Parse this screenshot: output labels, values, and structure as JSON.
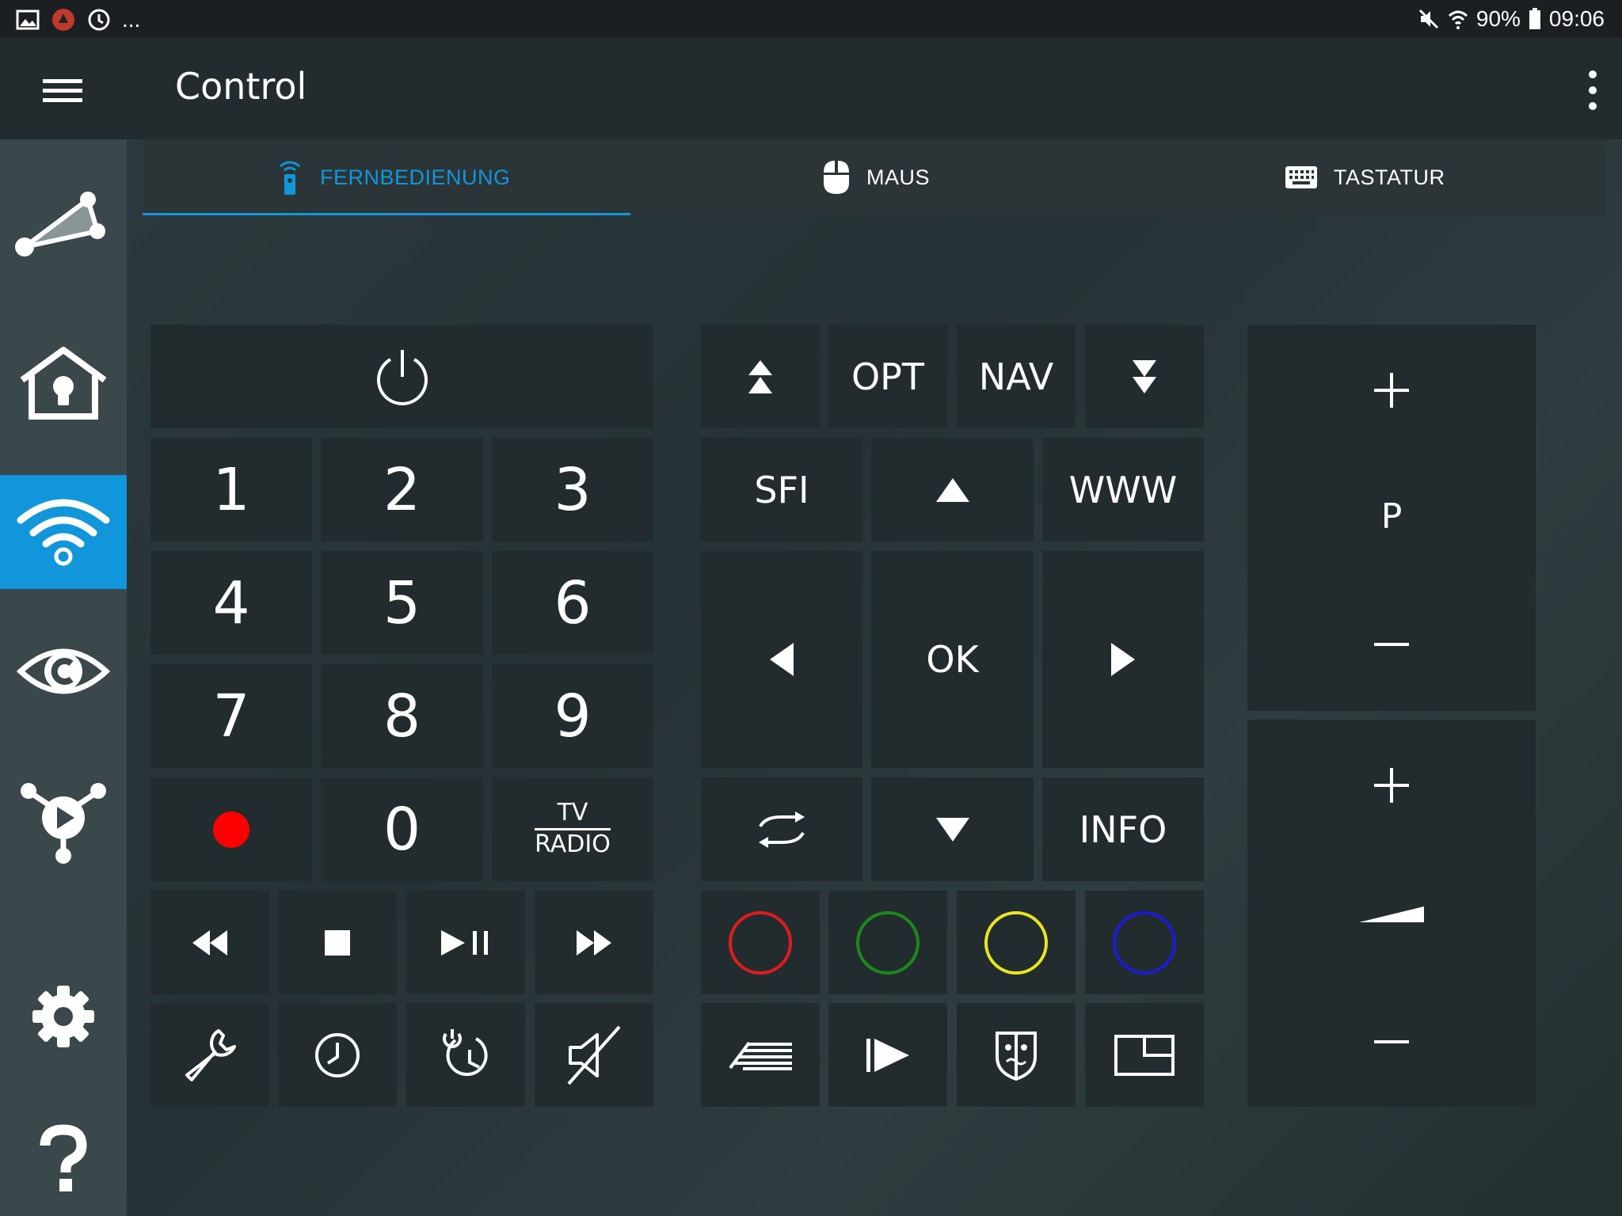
{
  "status_bar": {
    "battery": "90%",
    "time": "09:06",
    "more": "..."
  },
  "app_bar": {
    "title": "Control"
  },
  "tabs": [
    {
      "label": "FERNBEDIENUNG",
      "icon": "remote-icon",
      "active": true
    },
    {
      "label": "MAUS",
      "icon": "mouse-icon",
      "active": false
    },
    {
      "label": "TASTATUR",
      "icon": "keyboard-icon",
      "active": false
    }
  ],
  "sidebar": [
    {
      "icon": "network-icon"
    },
    {
      "icon": "smart-home-icon"
    },
    {
      "icon": "remote-control-icon",
      "active": true
    },
    {
      "icon": "eye-icon"
    },
    {
      "icon": "media-share-icon"
    },
    {
      "icon": "settings-icon"
    },
    {
      "icon": "help-icon"
    }
  ],
  "keypad": {
    "digits": [
      "1",
      "2",
      "3",
      "4",
      "5",
      "6",
      "7",
      "8",
      "9",
      "0"
    ],
    "tv": "TV",
    "radio": "RADIO"
  },
  "nav": {
    "opt": "OPT",
    "nav": "NAV",
    "sfi": "SFI",
    "www": "WWW",
    "ok": "OK",
    "info": "INFO"
  },
  "rockers": {
    "channel_letter": "P",
    "plus": "+",
    "minus": "–"
  },
  "colors": {
    "accent": "#1296db",
    "record": "#ff0000",
    "red": "#e21b1b",
    "green": "#1b8a1b",
    "yellow": "#e8e81c",
    "blue": "#1a1ad6",
    "key_bg": "#222c2f",
    "sidebar_bg": "#3a474b"
  }
}
